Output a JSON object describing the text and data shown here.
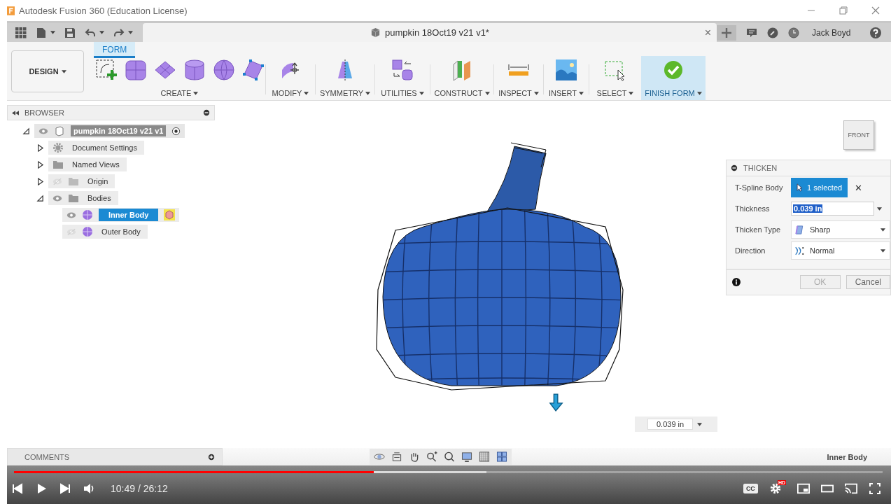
{
  "window": {
    "title": "Autodesk Fusion 360 (Education License)"
  },
  "document_tab": {
    "title": "pumpkin 18Oct19 v21 v1*",
    "close": "×"
  },
  "account": {
    "user": "Jack Boyd"
  },
  "workspace": {
    "label": "DESIGN"
  },
  "ribbon_tabs": [
    {
      "label": "FORM",
      "selected": true
    }
  ],
  "toolbar_groups": [
    {
      "label": "CREATE",
      "active": false
    },
    {
      "label": "MODIFY",
      "active": false
    },
    {
      "label": "SYMMETRY",
      "active": false
    },
    {
      "label": "UTILITIES",
      "active": false
    },
    {
      "label": "CONSTRUCT",
      "active": false
    },
    {
      "label": "INSPECT",
      "active": false
    },
    {
      "label": "INSERT",
      "active": false
    },
    {
      "label": "SELECT",
      "active": false
    },
    {
      "label": "FINISH FORM",
      "active": true
    }
  ],
  "browser": {
    "title": "BROWSER",
    "tree": [
      {
        "label": "pumpkin 18Oct19 v21 v1",
        "kind": "document",
        "expanded": true,
        "visible": true,
        "selected": false,
        "children": [
          {
            "label": "Document Settings",
            "kind": "settings",
            "expanded": false,
            "selected": false
          },
          {
            "label": "Named Views",
            "kind": "folder",
            "expanded": false,
            "selected": false
          },
          {
            "label": "Origin",
            "kind": "folder",
            "expanded": false,
            "visible": false,
            "selected": false
          },
          {
            "label": "Bodies",
            "kind": "folder",
            "expanded": true,
            "visible": true,
            "selected": false,
            "children": [
              {
                "label": "Inner Body",
                "kind": "body",
                "visible": true,
                "selected": true
              },
              {
                "label": "Outer Body",
                "kind": "body",
                "visible": false,
                "selected": false
              }
            ]
          }
        ]
      }
    ]
  },
  "view_cube": {
    "face": "FRONT"
  },
  "thicken_dialog": {
    "title": "THICKEN",
    "rows": [
      {
        "label": "T-Spline Body",
        "kind": "selection",
        "value": "1 selected",
        "clear": "✕"
      },
      {
        "label": "Thickness",
        "kind": "input",
        "value": "0.039 in"
      },
      {
        "label": "Thicken Type",
        "kind": "dropdown",
        "value": "Sharp"
      },
      {
        "label": "Direction",
        "kind": "dropdown",
        "value": "Normal"
      }
    ],
    "buttons": [
      {
        "label": "OK",
        "disabled": true
      },
      {
        "label": "Cancel",
        "disabled": false
      }
    ]
  },
  "value_input": {
    "value": "0.039 in"
  },
  "comments": {
    "title": "COMMENTS"
  },
  "status": {
    "selection": "Inner Body"
  },
  "player": {
    "progress": {
      "level": 0.414
    },
    "buffer": {
      "level": 0.544
    },
    "time": "10:49 / 26:12",
    "hd_badge": "HD",
    "captions": "CC"
  }
}
